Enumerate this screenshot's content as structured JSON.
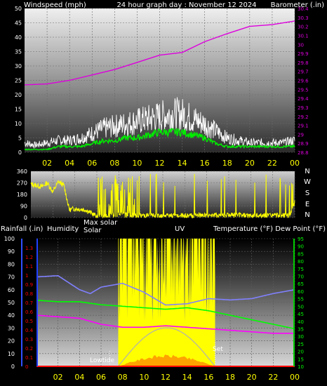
{
  "colors": {
    "bg": "#000000",
    "wind_gust": "#ffffff",
    "wind_avg": "#00ee00",
    "barometer": "#dd00dd",
    "direction": "#ffff00",
    "rain": "#ff0000",
    "humidity": "#8080ff",
    "solar": "#ffff00",
    "uv": "#ff9900",
    "temperature": "#ff00ff",
    "dewpoint": "#00ff00",
    "text": "#ffffff",
    "hour_tick": "#ffff00"
  },
  "chart_data": [
    {
      "type": "line",
      "title": "24 hour graph day : November 12 2024",
      "ylabel_left": "Windspeed (mph)",
      "ylabel_right": "Barometer (.in)",
      "ylim_left": [
        0,
        50
      ],
      "ylim_right": [
        28.8,
        30.4
      ],
      "yticks_left": [
        "0",
        "5",
        "10",
        "15",
        "20",
        "25",
        "30",
        "35",
        "40",
        "45",
        "50"
      ],
      "yticks_right": [
        "28.8",
        "28.9",
        "29",
        "29.1",
        "29.2",
        "29.3",
        "29.4",
        "29.5",
        "29.6",
        "29.7",
        "29.8",
        "29.9",
        "30",
        "30.1",
        "30.2",
        "30.3",
        "30.4"
      ],
      "x_hours": [
        "02",
        "04",
        "06",
        "08",
        "10",
        "12",
        "14",
        "16",
        "18",
        "20",
        "22",
        "00"
      ],
      "series": [
        {
          "name": "Windspeed (mph)",
          "role": "gust",
          "x": [
            0,
            1,
            2,
            3,
            4,
            5,
            6,
            7,
            8,
            9,
            10,
            11,
            12,
            13,
            14,
            15,
            16,
            17,
            18,
            19,
            20,
            21,
            22,
            23,
            24
          ],
          "values": [
            4,
            3,
            4,
            5,
            5,
            6,
            8,
            10,
            11,
            12,
            13,
            14,
            15,
            16,
            16,
            14,
            12,
            9,
            6,
            5,
            4,
            4,
            4,
            4,
            5
          ]
        },
        {
          "name": "Windspeed (mph)",
          "role": "average",
          "x": [
            0,
            1,
            2,
            3,
            4,
            5,
            6,
            7,
            8,
            9,
            10,
            11,
            12,
            13,
            14,
            15,
            16,
            17,
            18,
            19,
            20,
            21,
            22,
            23,
            24
          ],
          "values": [
            1,
            1,
            1,
            2,
            2,
            2,
            3,
            4,
            4,
            5,
            5,
            6,
            7,
            7,
            7,
            6,
            5,
            3,
            2,
            2,
            2,
            2,
            2,
            2,
            2
          ]
        },
        {
          "name": "Barometer (.in)",
          "x": [
            0,
            2,
            4,
            6,
            8,
            10,
            12,
            14,
            16,
            18,
            20,
            22,
            24
          ],
          "values": [
            29.55,
            29.56,
            29.6,
            29.66,
            29.72,
            29.8,
            29.88,
            29.91,
            30.03,
            30.12,
            30.2,
            30.22,
            30.26
          ]
        }
      ]
    },
    {
      "type": "line",
      "ylim": [
        0,
        360
      ],
      "yticks": [
        "0",
        "90",
        "180",
        "270",
        "360"
      ],
      "compass": [
        "N",
        "W",
        "S",
        "E",
        "N"
      ],
      "x_hours": [
        "02",
        "04",
        "06",
        "08",
        "10",
        "12",
        "14",
        "16",
        "18",
        "20",
        "22",
        "00"
      ],
      "series": [
        {
          "name": "Wind direction",
          "x": [
            0,
            1,
            1.5,
            2,
            2.5,
            3,
            3.5,
            4,
            5,
            6,
            8,
            10,
            12,
            14,
            16,
            18,
            20,
            22,
            23.5,
            24
          ],
          "values": [
            260,
            240,
            270,
            200,
            280,
            250,
            60,
            70,
            60,
            10,
            20,
            15,
            15,
            12,
            18,
            20,
            15,
            15,
            15,
            120
          ]
        }
      ]
    },
    {
      "type": "line",
      "labels": {
        "rain": "Rainfall (.in)",
        "humidity": "Humidity",
        "max_solar": "Max solar",
        "solar": "Solar",
        "uv": "UV",
        "temp": "Temperature (°F) Dew Point (°F)"
      },
      "yticks_left_humidity": [
        "0",
        "10",
        "20",
        "30",
        "40",
        "50",
        "60",
        "70",
        "80",
        "90",
        "100"
      ],
      "yticks_left_rain": [
        "0",
        "0.1",
        "0.2",
        "0.3",
        "0.4",
        "0.5",
        "0.6",
        "0.7",
        "0.8",
        "0.9",
        "1",
        "1.1",
        "1.2",
        "1.3"
      ],
      "yticks_right_temp": [
        "10",
        "15",
        "20",
        "25",
        "30",
        "35",
        "40",
        "45",
        "50",
        "55",
        "60",
        "65",
        "70",
        "75",
        "80",
        "85",
        "90",
        "95"
      ],
      "ylim_humidity": [
        0,
        100
      ],
      "ylim_rain": [
        0,
        1.4
      ],
      "ylim_temp": [
        10,
        95
      ],
      "x_hours": [
        "02",
        "04",
        "06",
        "08",
        "10",
        "12",
        "14",
        "16",
        "18",
        "20",
        "22",
        "00"
      ],
      "annotations": {
        "lowtide": "Lowtide",
        "set": "Set"
      },
      "series": [
        {
          "name": "Humidity",
          "x": [
            0,
            2,
            4,
            5,
            6,
            8,
            10,
            12,
            14,
            16,
            18,
            20,
            22,
            24
          ],
          "values": [
            70,
            71,
            60,
            57,
            62,
            65,
            58,
            48,
            49,
            53,
            52,
            53,
            57,
            60
          ]
        },
        {
          "name": "Temperature (°F)",
          "x": [
            0,
            2,
            4,
            6,
            8,
            10,
            12,
            14,
            16,
            18,
            20,
            22,
            24
          ],
          "values": [
            44,
            43,
            42,
            38,
            36,
            36,
            37,
            36,
            35,
            34,
            33,
            32,
            32
          ]
        },
        {
          "name": "Dew Point (°F)",
          "x": [
            0,
            2,
            4,
            6,
            8,
            10,
            12,
            14,
            16,
            18,
            20,
            22,
            24
          ],
          "values": [
            54,
            53,
            53,
            51,
            50,
            49,
            48,
            49,
            47,
            44,
            41,
            38,
            35
          ]
        },
        {
          "name": "Rainfall (.in)",
          "x": [
            0,
            24
          ],
          "values": [
            0,
            0
          ]
        }
      ],
      "solar_window": {
        "start_hour": 7.6,
        "end_hour": 16.6
      }
    }
  ]
}
